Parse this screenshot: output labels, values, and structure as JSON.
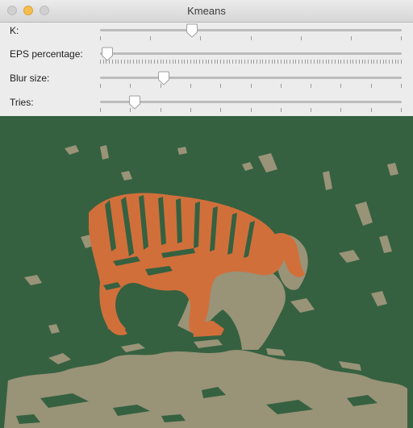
{
  "window": {
    "title": "Kmeans"
  },
  "sliders": [
    {
      "label": "K:",
      "value_fraction": 0.305,
      "ticks": 7
    },
    {
      "label": "EPS percentage:",
      "value_fraction": 0.024,
      "ticks": 101
    },
    {
      "label": "Blur size:",
      "value_fraction": 0.21,
      "ticks": 11
    },
    {
      "label": "Tries:",
      "value_fraction": 0.115,
      "ticks": 11
    }
  ],
  "image_colors": {
    "background": "#356140",
    "tiger": "#d16f3b",
    "beige": "#999378"
  }
}
